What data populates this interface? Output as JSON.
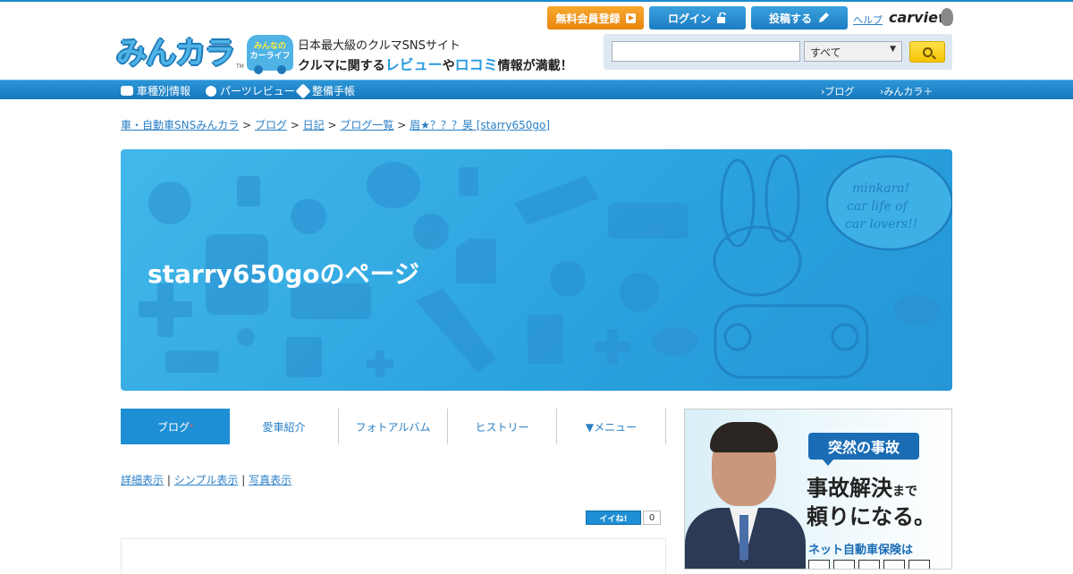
{
  "header": {
    "logo_text": "みんカラ",
    "logo_tm": "TM",
    "carlife_line1": "みんなの",
    "carlife_line2": "カーライフ",
    "tagline1": "日本最大級のクルマSNSサイト",
    "tagline2_a": "クルマに関する",
    "tagline2_b": "レビュー",
    "tagline2_c": "や",
    "tagline2_d": "ロコミ",
    "tagline2_e": "情報が満載！",
    "register_label": "無料会員登録",
    "login_label": "ログイン",
    "post_label": "投稿する",
    "help_label": "ヘルプ",
    "carview_label": "carview",
    "search": {
      "input_value": "",
      "select_value": "すべて"
    }
  },
  "nav": {
    "left": [
      "車種別情報",
      "パーツレビュー",
      "整備手帳"
    ],
    "right": [
      "›ブログ",
      "›みんカラ＋"
    ]
  },
  "breadcrumb": {
    "items": [
      "車・自動車SNSみんカラ",
      "ブログ",
      "日記",
      "ブログ一覧",
      "眉★？？？昊 [starry650go]"
    ],
    "separator": ">"
  },
  "banner": {
    "title": "starry650goのページ",
    "bubble_text": "minkara! car life of car lovers!!"
  },
  "tabs": [
    {
      "label": "ブログ",
      "active": true,
      "mark": "*"
    },
    {
      "label": "愛車紹介",
      "active": false
    },
    {
      "label": "フォトアルバム",
      "active": false
    },
    {
      "label": "ヒストリー",
      "active": false
    },
    {
      "label": "▼メニュー",
      "active": false
    }
  ],
  "view_links": [
    "詳細表示",
    "シンプル表示",
    "写真表示"
  ],
  "iine": {
    "label": "イイね!",
    "count": "0"
  },
  "ad": {
    "badge": "突然の事故",
    "line1_a": "事故解決",
    "line1_b": "まで",
    "line2": "頼りになる。",
    "line3": "ネット自動車保険は"
  },
  "colors": {
    "brand_blue": "#1e8fd4",
    "register_orange": "#f09a1e",
    "search_yellow": "#f5c400"
  }
}
